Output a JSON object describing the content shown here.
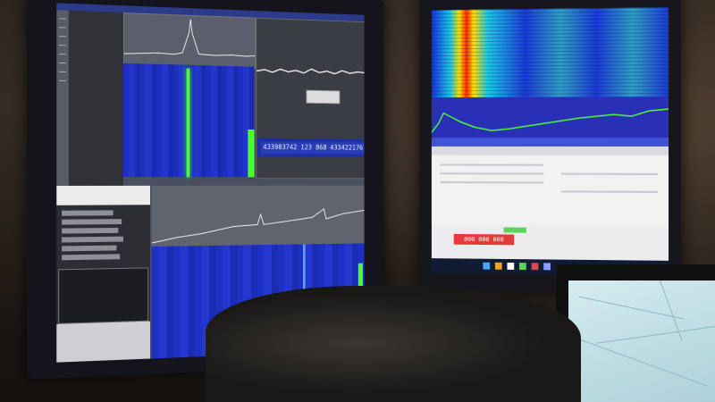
{
  "scene": {
    "description_type": "photo of SDR monitoring workstation",
    "left_monitor": {
      "frequency_readouts": [
        "433983742",
        "123 868",
        "433422176"
      ],
      "accent_colors": {
        "waterfall_blue": "#1f33c6",
        "signal_green": "#4cff2f",
        "ui_gray": "#4a4f60"
      }
    },
    "right_monitor": {
      "record_button_label": "000 000 000",
      "accent_colors": {
        "waterfall_hot": "#ff2a00",
        "waterfall_cold": "#1a2ee0",
        "record_red": "#e63a3a",
        "ok_green": "#5ad35a"
      }
    },
    "laptop": {
      "content": "map-view"
    }
  }
}
